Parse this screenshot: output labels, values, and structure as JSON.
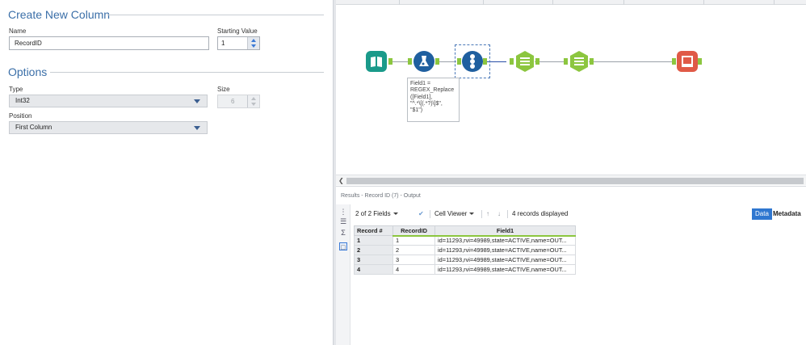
{
  "config": {
    "create_title": "Create New Column",
    "name_label": "Name",
    "name_value": "RecordID",
    "start_label": "Starting Value",
    "start_value": "1",
    "options_title": "Options",
    "type_label": "Type",
    "type_value": "Int32",
    "size_label": "Size",
    "size_value": "6",
    "position_label": "Position",
    "position_value": "First Column"
  },
  "canvas": {
    "annotation_lines": [
      "Field1 =",
      "REGEX_Replace",
      "([Field1],",
      "\"^.*\\[(.*?)\\]$\",",
      "\"$1\")"
    ],
    "tool_icons": [
      "input-data-icon",
      "formula-icon",
      "record-id-icon",
      "select-icon",
      "select-icon",
      "output-data-icon"
    ],
    "colors": {
      "input": "#1a9a8a",
      "formula": "#1f5f9f",
      "record_id": "#1f5f9f",
      "select": "#8cc63f",
      "output": "#e05a47"
    }
  },
  "results": {
    "header": "Results - Record ID (7) - Output",
    "fields_label": "2 of 2 Fields",
    "cell_viewer_label": "Cell Viewer",
    "records_label": "4 records displayed",
    "data_tab": "Data",
    "metadata_tab": "Metadata",
    "columns": [
      "Record #",
      "RecordID",
      "Field1"
    ],
    "rows": [
      [
        "1",
        "1",
        "id=11293,rvi=49989,state=ACTIVE,name=OUT..."
      ],
      [
        "2",
        "2",
        "id=11293,rvi=49989,state=ACTIVE,name=OUT..."
      ],
      [
        "3",
        "3",
        "id=11293,rvi=49989,state=ACTIVE,name=OUT..."
      ],
      [
        "4",
        "4",
        "id=11293,rvi=49989,state=ACTIVE,name=OUT..."
      ]
    ]
  }
}
